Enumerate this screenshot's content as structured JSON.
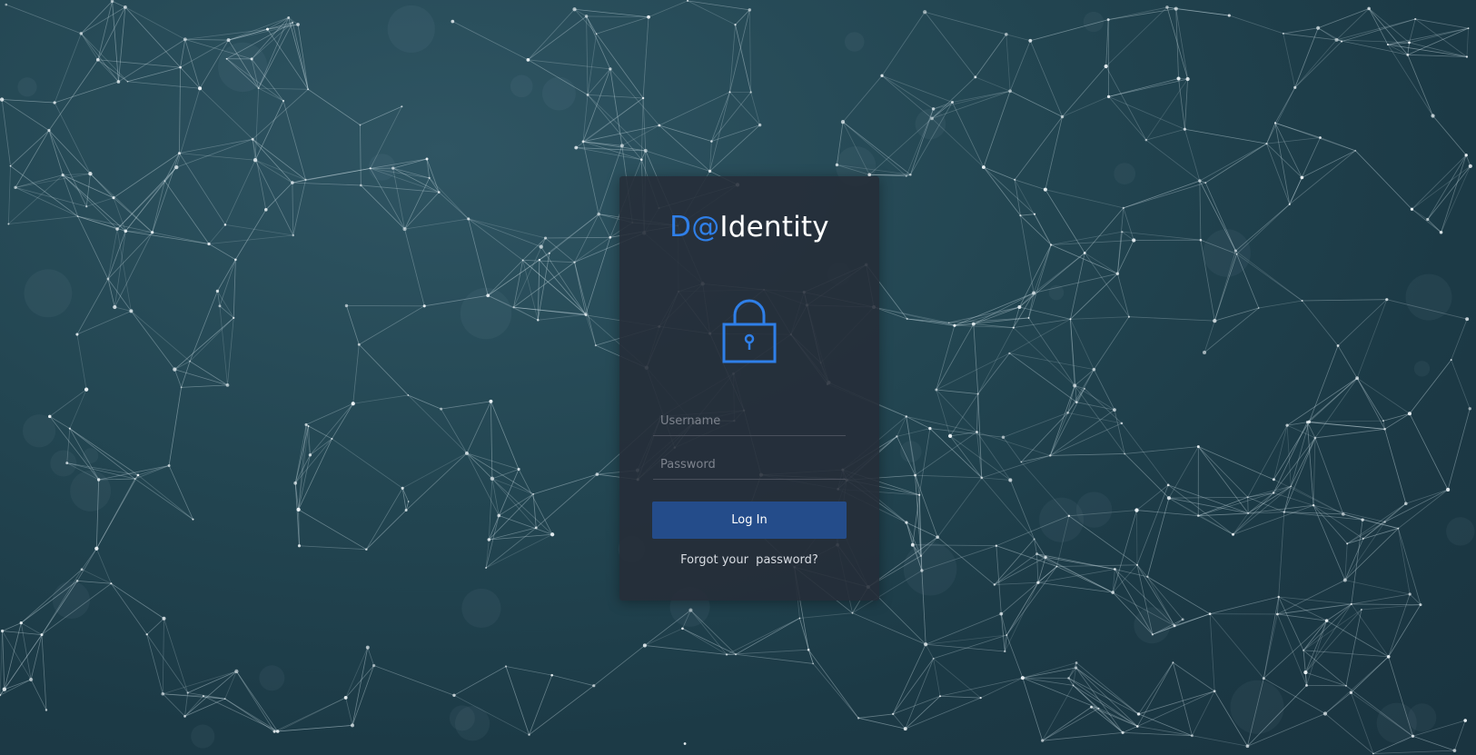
{
  "brand": {
    "prefix": "D@",
    "name": "Identity",
    "accent_color": "#2f7fe8"
  },
  "lock_icon": "lock-icon",
  "form": {
    "username_placeholder": "Username",
    "username_value": "",
    "password_placeholder": "Password",
    "password_value": "",
    "login_label": "Log In",
    "forgot_label": "Forgot your  password?"
  },
  "colors": {
    "button": "#244c8a",
    "card": "#262c38",
    "background": "#1f3f4b"
  }
}
